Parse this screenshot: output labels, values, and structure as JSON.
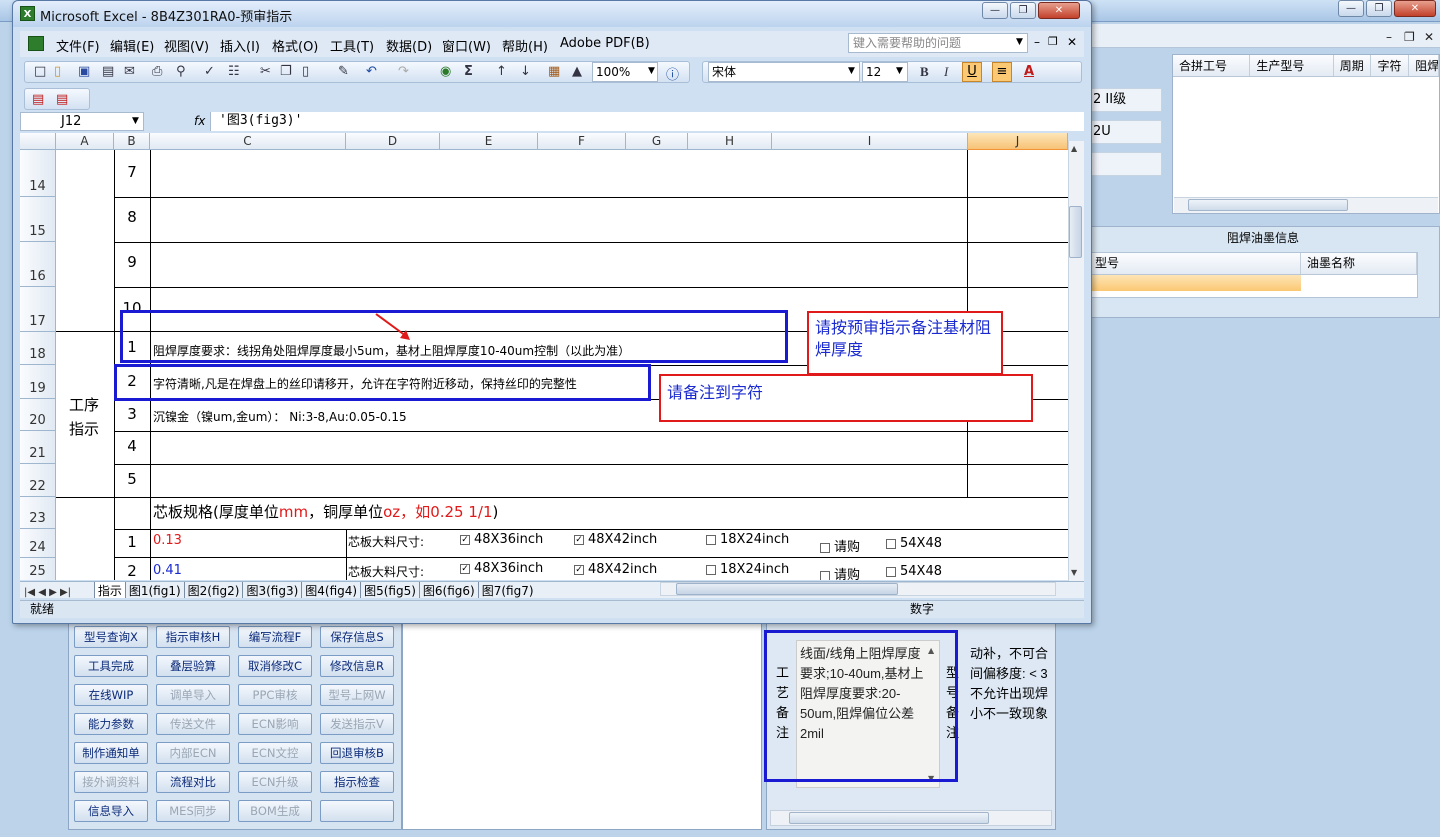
{
  "background": {
    "fields": [
      "2 II级",
      "2U",
      ""
    ],
    "grid1_headers": [
      "合拼工号",
      "生产型号",
      "周期",
      "字符",
      "阻焊"
    ],
    "grid2_title": "阻焊油墨信息",
    "grid2_headers": [
      "型号",
      "油墨名称"
    ],
    "buttons": [
      [
        "型号查询X",
        "指示审核H",
        "编写流程F",
        "保存信息S"
      ],
      [
        "工具完成",
        "叠层验算",
        "取消修改C",
        "修改信息R"
      ],
      [
        "在线WIP",
        "调单导入",
        "PPC审核",
        "型号上网W"
      ],
      [
        "能力参数",
        "传送文件",
        "ECN影响",
        "发送指示V"
      ],
      [
        "制作通知单",
        "内部ECN",
        "ECN文控",
        "回退审核B"
      ],
      [
        "接外调资料",
        "流程对比",
        "ECN升级",
        "指示检查"
      ],
      [
        "信息导入",
        "MES同步",
        "BOM生成",
        ""
      ]
    ],
    "disabled_buttons": [
      "调单导入",
      "PPC审核",
      "型号上网W",
      "传送文件",
      "ECN影响",
      "发送指示V",
      "内部ECN",
      "ECN文控",
      "接外调资料",
      "ECN升级",
      "MES同步",
      "BOM生成"
    ],
    "remark_label": "工艺备注",
    "remark_text": "线面/线角上阻焊厚度要求;10-40um,基材上阻焊厚度要求:20-50um,阻焊偏位公差2mil",
    "remark_label2": "型号备注",
    "remark_text2_lines": [
      "动补，不可合",
      "间偏移度: < 3",
      "不允许出现焊",
      "小不一致现象"
    ]
  },
  "excel": {
    "title": "Microsoft Excel - 8B4Z301RA0-预审指示",
    "logo": "X",
    "menu": [
      "文件(F)",
      "编辑(E)",
      "视图(V)",
      "插入(I)",
      "格式(O)",
      "工具(T)",
      "数据(D)",
      "窗口(W)",
      "帮助(H)",
      "Adobe PDF(B)"
    ],
    "help_placeholder": "键入需要帮助的问题",
    "zoom": "100%",
    "font": "宋体",
    "font_size": "12",
    "name_box": "J12",
    "fx": "fx",
    "formula": "'图3(fig3)'",
    "columns": [
      "A",
      "B",
      "C",
      "D",
      "E",
      "F",
      "G",
      "H",
      "I",
      "J"
    ],
    "rows": [
      "14",
      "15",
      "16",
      "17",
      "18",
      "19",
      "20",
      "21",
      "22",
      "23",
      "24",
      "25"
    ],
    "b_numbers": [
      "7",
      "8",
      "9",
      "10",
      "1",
      "2",
      "3",
      "4",
      "5",
      "",
      "1",
      "2"
    ],
    "section_label": "工序指示",
    "row18_text": "阻焊厚度要求：线拐角处阻焊厚度最小5um，基材上阻焊厚度10-40um控制（以此为准）",
    "row19_text": "字符清晰,凡是在焊盘上的丝印请移开，允许在字符附近移动，保持丝印的完整性",
    "row20_text": "沉镍金（镍um,金um）： Ni:3-8,Au:0.05-0.15",
    "row23": {
      "prefix": "芯板规格(厚度单位",
      "unit1": "mm",
      "mid": "，铜厚单位",
      "unit2": "oz",
      "suffix1": "，如",
      "example": "0.25 1/1",
      "suffix2": ")"
    },
    "row24": {
      "value": "0.13",
      "label": "芯板大料尺寸:",
      "opts": [
        "48X36inch",
        "48X42inch",
        "18X24inch",
        "请购",
        "54X48"
      ],
      "checked": [
        true,
        true,
        false,
        false,
        false
      ]
    },
    "row25": {
      "value": "0.41",
      "label": "芯板大料尺寸:",
      "opts": [
        "48X36inch",
        "48X42inch",
        "18X24inch",
        "请购",
        "54X48"
      ],
      "checked": [
        true,
        true,
        false,
        false,
        false
      ]
    },
    "sheet_tabs": [
      "指示",
      "图1(fig1)",
      "图2(fig2)",
      "图3(fig3)",
      "图4(fig4)",
      "图5(fig5)",
      "图6(fig6)",
      "图7(fig7)"
    ],
    "status": "就绪",
    "status_right": "数字"
  },
  "annotations": {
    "callout1": "请按预审指示备注基材阻焊厚度",
    "callout2": "请备注到字符"
  },
  "colors": {
    "blue_box": "#1a1ad2",
    "red_box": "#e01a1a",
    "callout_text": "#1a2ad0",
    "red_text": "#e01a1a",
    "blue_text": "#1a2ad0"
  }
}
